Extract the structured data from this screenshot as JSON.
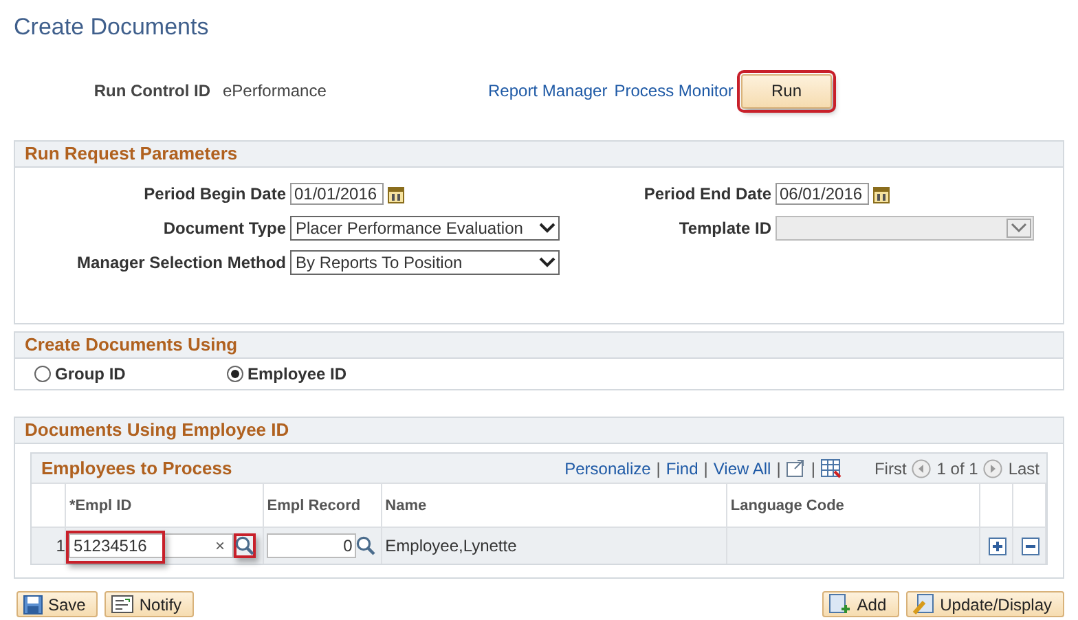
{
  "page_title": "Create Documents",
  "run_control": {
    "label": "Run Control ID",
    "value": "ePerformance",
    "links": [
      "Report Manager",
      "Process Monitor"
    ],
    "run_button": {
      "label": "Run",
      "highlighted": true
    }
  },
  "run_request_parameters": {
    "title": "Run Request Parameters",
    "fields": [
      {
        "kind": "date",
        "label": "Period Begin Date",
        "value": "01/01/2016"
      },
      {
        "kind": "date",
        "label": "Period End Date",
        "value": "06/01/2016"
      },
      {
        "kind": "select",
        "label": "Document Type",
        "value": "Placer Performance Evaluation",
        "disabled": false
      },
      {
        "kind": "select",
        "label": "Template ID",
        "disabled": true
      },
      {
        "kind": "select",
        "label": "Manager Selection Method",
        "value": "By Reports To Position",
        "disabled": false
      }
    ]
  },
  "create_documents_using": {
    "title": "Create Documents Using",
    "options": [
      {
        "label": "Group ID",
        "selected": false
      },
      {
        "label": "Employee ID",
        "selected": true
      }
    ]
  },
  "documents_using_employee_id": {
    "title": "Documents Using Employee ID",
    "grid": {
      "title": "Employees to Process",
      "toolbar_links": [
        "Personalize",
        "Find",
        "View All"
      ],
      "separator": "|",
      "nav": {
        "first": "First",
        "count": "1 of 1",
        "last": "Last"
      },
      "columns": [
        "*Empl ID",
        "Empl Record",
        "Name",
        "Language Code"
      ],
      "rows": [
        {
          "number": "1",
          "empl_id": "51234516",
          "empl_id_highlighted": true,
          "clear_symbol": "×",
          "lookup_highlighted": true,
          "empl_record": "0",
          "name": "Employee,Lynette"
        }
      ]
    }
  },
  "footer_left": [
    {
      "kind": "save",
      "label": "Save"
    },
    {
      "kind": "notify",
      "label": "Notify"
    }
  ],
  "footer_right": [
    {
      "kind": "add",
      "label": "Add"
    },
    {
      "kind": "update",
      "label": "Update/Display"
    }
  ]
}
